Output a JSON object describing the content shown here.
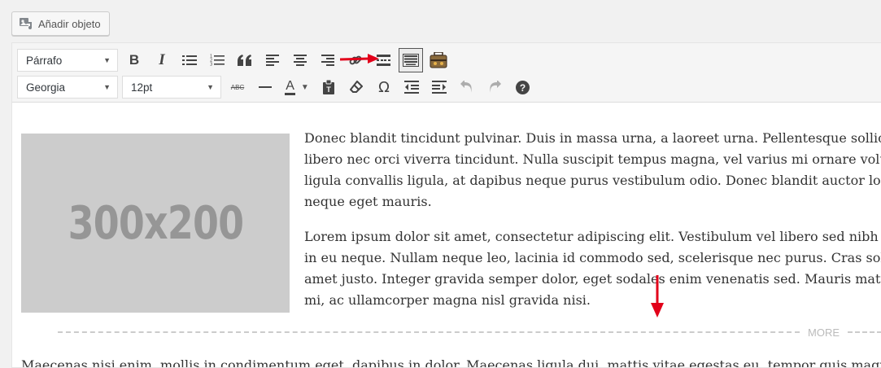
{
  "add_media": {
    "label": "Añadir objeto",
    "icon": "add-media-icon"
  },
  "toolbar": {
    "format_select": "Párrafo",
    "font_family_select": "Georgia",
    "font_size_select": "12pt",
    "strikethrough_label": "ABC",
    "omega_label": "Ω",
    "text_color_label": "A",
    "bold_label": "B",
    "italic_label": "I",
    "quote_label": "“"
  },
  "content": {
    "placeholder_text": "300x200",
    "paragraph1_lines": [
      "Donec blandit tincidunt pulvinar. Duis in massa urna, a laoreet urna. Pellentesque sollicit",
      "libero nec orci viverra tincidunt. Nulla suscipit tempus magna, vel varius mi ornare volutp",
      "ligula convallis ligula, at dapibus neque purus vestibulum odio. Donec blandit auctor lorem",
      "neque eget mauris."
    ],
    "paragraph2_lines": [
      "Lorem ipsum dolor sit amet, consectetur adipiscing elit. Vestibulum vel libero sed nibh pla",
      "in eu neque. Nullam neque leo, lacinia id commodo sed, scelerisque nec purus. Cras sollicit",
      "amet justo. Integer gravida semper dolor, eget sodales enim venenatis sed. Mauris mattis",
      "mi, ac ullamcorper magna nisl gravida nisi."
    ],
    "more_label": "MORE",
    "bottom_line": "Maecenas nisi enim, mollis in condimentum eget, dapibus in dolor. Maecenas ligula dui, mattis vitae egestas eu, tempor quis magna. S"
  },
  "colors": {
    "annotation_arrow": "#e2001a"
  }
}
